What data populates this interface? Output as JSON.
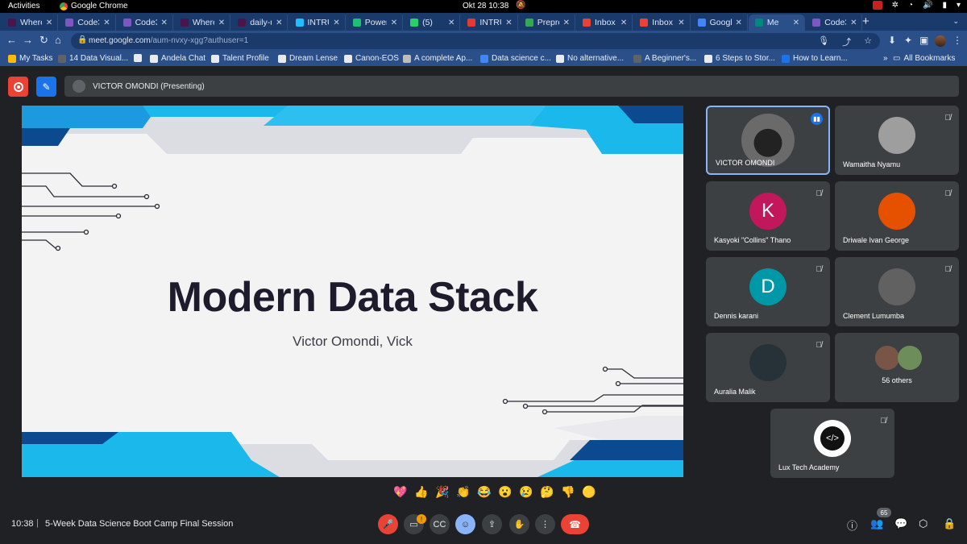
{
  "system_bar": {
    "activities": "Activities",
    "app_name": "Google Chrome",
    "datetime": "Okt 28  10:38"
  },
  "browser": {
    "tabs": [
      {
        "label": "Where",
        "color": "#4a154b"
      },
      {
        "label": "Code3",
        "color": "#7e57c2"
      },
      {
        "label": "Code3",
        "color": "#7e57c2"
      },
      {
        "label": "Where",
        "color": "#4a154b"
      },
      {
        "label": "daily-u",
        "color": "#4a154b"
      },
      {
        "label": "INTRU",
        "color": "#20beff"
      },
      {
        "label": "Power",
        "color": "#1dbf73"
      },
      {
        "label": "(5)",
        "color": "#25d366"
      },
      {
        "label": "INTRU",
        "color": "#e53935"
      },
      {
        "label": "Prepro",
        "color": "#34a853"
      },
      {
        "label": "Inbox",
        "color": "#ea4335"
      },
      {
        "label": "Inbox",
        "color": "#ea4335"
      },
      {
        "label": "Googl",
        "color": "#4285f4"
      },
      {
        "label": "Me",
        "color": "#00897b"
      },
      {
        "label": "Code3",
        "color": "#7e57c2"
      }
    ],
    "url_host": "meet.google.com",
    "url_path": "/aum-nvxy-xgg?authuser=1",
    "bookmarks": [
      {
        "label": "My Tasks",
        "color": "#fbbc04"
      },
      {
        "label": "14 Data Visual...",
        "color": "#5f6368"
      },
      {
        "label": "",
        "color": "#e8eaed"
      },
      {
        "label": "Andela Chat",
        "color": "#e8eaed"
      },
      {
        "label": "Talent Profile",
        "color": "#e8eaed"
      },
      {
        "label": "Dream Lense",
        "color": "#e8eaed"
      },
      {
        "label": "Canon-EOS",
        "color": "#e8eaed"
      },
      {
        "label": "A complete Ap...",
        "color": "#bdbdbd"
      },
      {
        "label": "Data science c...",
        "color": "#4285f4"
      },
      {
        "label": "No alternative...",
        "color": "#e8eaed"
      },
      {
        "label": "A Beginner's...",
        "color": "#5f6368"
      },
      {
        "label": "6 Steps to Stor...",
        "color": "#e8eaed"
      },
      {
        "label": "How to Learn...",
        "color": "#1a73e8"
      }
    ],
    "all_bookmarks": "All Bookmarks"
  },
  "meet": {
    "presenter_label": "VICTOR OMONDI (Presenting)",
    "slide": {
      "title": "Modern Data Stack",
      "subtitle": "Victor Omondi, Vick"
    },
    "participants": [
      {
        "name": "VICTOR OMONDI",
        "initial": "",
        "color": "#5f6368",
        "speaking": true
      },
      {
        "name": "Wamaitha Nyamu",
        "initial": "",
        "color": "#9e9e9e",
        "speaking": false
      },
      {
        "name": "Kasyoki \"Collins\" Thano",
        "initial": "K",
        "color": "#c2185b",
        "speaking": false
      },
      {
        "name": "Driwale Ivan George",
        "initial": "",
        "color": "#e65100",
        "speaking": false
      },
      {
        "name": "Dennis karani",
        "initial": "D",
        "color": "#0097a7",
        "speaking": false
      },
      {
        "name": "Clement Lumumba",
        "initial": "",
        "color": "#616161",
        "speaking": false
      },
      {
        "name": "Auralia Malik",
        "initial": "",
        "color": "#263238",
        "speaking": false
      },
      {
        "name": "56 others",
        "initial": "",
        "color": "#795548",
        "speaking": false
      },
      {
        "name": "Lux Tech Academy",
        "initial": "",
        "color": "#111111",
        "speaking": false
      }
    ],
    "reactions": [
      "💖",
      "👍",
      "🎉",
      "👏",
      "😂",
      "😮",
      "😢",
      "🤔",
      "👎",
      "🟡"
    ],
    "bottom": {
      "time": "10:38",
      "separator": "|",
      "meeting_title": "5-Week Data Science Boot Camp Final Session",
      "camera_alert": "!",
      "people_count": "65"
    }
  }
}
